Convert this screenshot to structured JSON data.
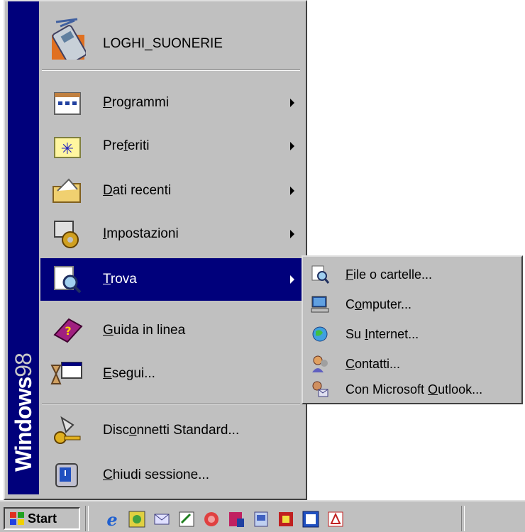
{
  "brand": {
    "bold": "Windows",
    "light": "98"
  },
  "start_menu": {
    "top_item": {
      "label": "LOGHI_SUONERIE",
      "icon": "phone-icon"
    },
    "items": [
      {
        "label": "Programmi",
        "ul": "P",
        "rest": "rogrammi",
        "pre": "",
        "icon": "programs-icon",
        "submenu": true
      },
      {
        "label": "Preferiti",
        "pre": "Pre",
        "ul": "f",
        "rest": "eriti",
        "icon": "favorites-folder-icon",
        "submenu": true
      },
      {
        "label": "Dati recenti",
        "pre": "",
        "ul": "D",
        "rest": "ati recenti",
        "icon": "documents-folder-icon",
        "submenu": true
      },
      {
        "label": "Impostazioni",
        "pre": "",
        "ul": "I",
        "rest": "mpostazioni",
        "icon": "settings-icon",
        "submenu": true
      },
      {
        "label": "Trova",
        "pre": "",
        "ul": "T",
        "rest": "rova",
        "icon": "find-icon",
        "submenu": true,
        "active": true
      },
      {
        "label": "Guida in linea",
        "pre": "",
        "ul": "G",
        "rest": "uida in linea",
        "icon": "help-book-icon",
        "submenu": false
      },
      {
        "label": "Esegui...",
        "pre": "",
        "ul": "E",
        "rest": "segui...",
        "icon": "run-icon",
        "submenu": false
      }
    ],
    "bottom_items": [
      {
        "label": "Disconnetti Standard...",
        "pre": "Disc",
        "ul": "o",
        "rest": "nnetti Standard...",
        "icon": "logoff-key-icon"
      },
      {
        "label": "Chiudi sessione...",
        "pre": "",
        "ul": "C",
        "rest": "hiudi sessione...",
        "icon": "shutdown-icon"
      }
    ]
  },
  "find_submenu": [
    {
      "label": "File o cartelle...",
      "pre": "",
      "ul": "F",
      "rest": "ile o cartelle...",
      "icon": "file-search-icon"
    },
    {
      "label": "Computer...",
      "pre": "C",
      "ul": "o",
      "rest": "mputer...",
      "icon": "computer-icon"
    },
    {
      "label": "Su Internet...",
      "pre": "Su ",
      "ul": "I",
      "rest": "nternet...",
      "icon": "internet-globe-icon"
    },
    {
      "label": "Contatti...",
      "pre": "",
      "ul": "C",
      "rest": "ontatti...",
      "icon": "contacts-icon"
    },
    {
      "label": "Con Microsoft Outlook...",
      "pre": "Con Microsoft ",
      "ul": "O",
      "rest": "utlook...",
      "icon": "outlook-find-icon"
    }
  ],
  "taskbar": {
    "start_label": "Start",
    "quick_launch": [
      "ie-icon",
      "screen-icon",
      "mail-icon",
      "notepad-icon",
      "swirl-icon",
      "app-icon",
      "doc-icon",
      "multimedia-icon",
      "window-icon",
      "acrobat-icon"
    ]
  }
}
